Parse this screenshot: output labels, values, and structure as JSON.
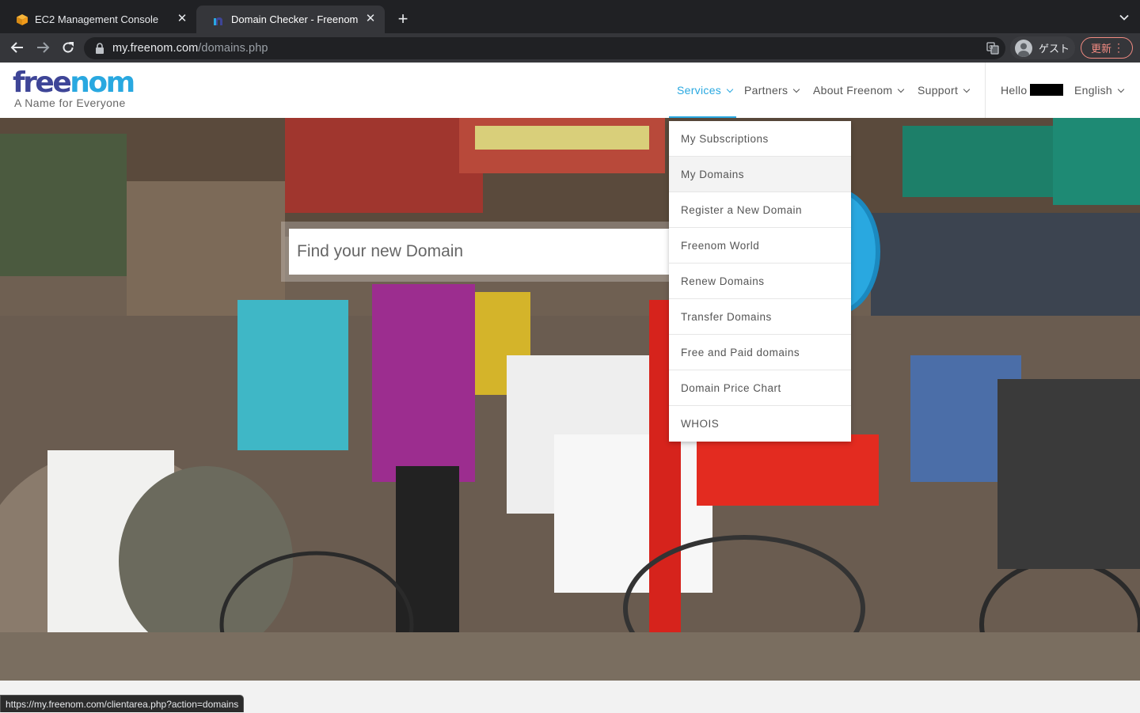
{
  "browser": {
    "tabs": [
      {
        "title": "EC2 Management Console",
        "favicon": "aws-cube-icon",
        "active": false
      },
      {
        "title": "Domain Checker - Freenom",
        "favicon": "freenom-n-icon",
        "active": true
      }
    ],
    "url_host": "my.freenom.com",
    "url_path": "/domains.php",
    "profile_label": "ゲスト",
    "update_label": "更新",
    "status_url": "https://my.freenom.com/clientarea.php?action=domains"
  },
  "site": {
    "brand_colors": {
      "primary": "#3e4597",
      "accent": "#29a8e0"
    },
    "logo": {
      "part1": "free",
      "part2": "nom",
      "tagline": "A Name for Everyone"
    },
    "nav": {
      "services": "Services",
      "partners": "Partners",
      "about": "About Freenom",
      "support": "Support",
      "hello": "Hello",
      "language": "English"
    },
    "search": {
      "placeholder": "Find your new Domain"
    },
    "services_menu": [
      "My Subscriptions",
      "My Domains",
      "Register a New Domain",
      "Freenom World",
      "Renew Domains",
      "Transfer Domains",
      "Free and Paid domains",
      "Domain Price Chart",
      "WHOIS"
    ]
  }
}
